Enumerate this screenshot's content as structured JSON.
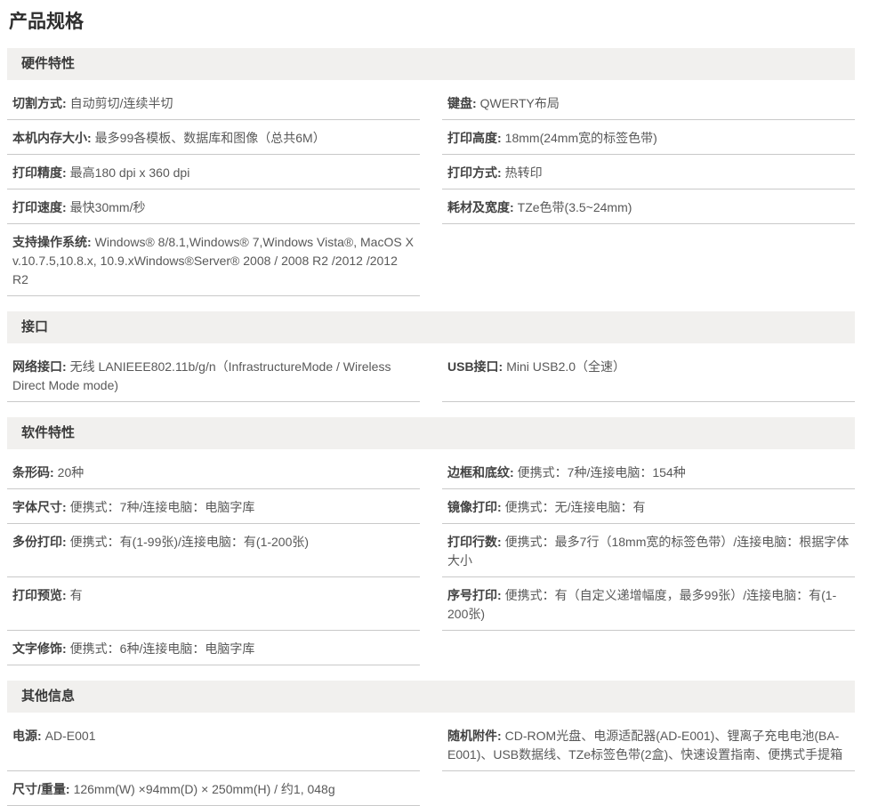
{
  "page": {
    "title": "产品规格"
  },
  "colors": {
    "section_header_bg": "#f1f0ee",
    "row_border": "#c9c9c9",
    "label_text": "#424242",
    "value_text": "#595959"
  },
  "sections": [
    {
      "header": "硬件特性",
      "rows": [
        {
          "left": {
            "label": "切割方式:",
            "value": "自动剪切/连续半切"
          },
          "right": {
            "label": "键盘:",
            "value": "QWERTY布局"
          }
        },
        {
          "left": {
            "label": "本机内存大小:",
            "value": "最多99各模板、数据库和图像（总共6M）"
          },
          "right": {
            "label": "打印高度:",
            "value": "18mm(24mm宽的标签色带)"
          }
        },
        {
          "left": {
            "label": "打印精度:",
            "value": "最高180 dpi x 360 dpi"
          },
          "right": {
            "label": "打印方式:",
            "value": "热转印"
          }
        },
        {
          "left": {
            "label": "打印速度:",
            "value": "最快30mm/秒"
          },
          "right": {
            "label": "耗材及宽度:",
            "value": "TZe色带(3.5~24mm)"
          }
        },
        {
          "left": {
            "label": "支持操作系统:",
            "value": "Windows® 8/8.1,Windows® 7,Windows Vista®, MacOS X v.10.7.5,10.8.x, 10.9.xWindows®Server® 2008 / 2008 R2 /2012 /2012 R2"
          }
        }
      ]
    },
    {
      "header": "接口",
      "rows": [
        {
          "left": {
            "label": "网络接口:",
            "value": "无线 LANIEEE802.11b/g/n（InfrastructureMode / Wireless Direct Mode mode)"
          },
          "right": {
            "label": "USB接口:",
            "value": "Mini USB2.0（全速）"
          }
        }
      ]
    },
    {
      "header": "软件特性",
      "rows": [
        {
          "left": {
            "label": "条形码:",
            "value": "20种"
          },
          "right": {
            "label": "边框和底纹:",
            "value": "便携式：7种/连接电脑：154种"
          }
        },
        {
          "left": {
            "label": "字体尺寸:",
            "value": "便携式：7种/连接电脑：电脑字库"
          },
          "right": {
            "label": "镜像打印:",
            "value": "便携式：无/连接电脑：有"
          }
        },
        {
          "left": {
            "label": "多份打印:",
            "value": "便携式：有(1-99张)/连接电脑：有(1-200张)"
          },
          "right": {
            "label": "打印行数:",
            "value": "便携式：最多7行（18mm宽的标签色带）/连接电脑：根据字体大小"
          }
        },
        {
          "left": {
            "label": "打印预览:",
            "value": "有"
          },
          "right": {
            "label": "序号打印:",
            "value": "便携式：有（自定义递增幅度，最多99张）/连接电脑：有(1-200张)"
          }
        },
        {
          "left": {
            "label": "文字修饰:",
            "value": "便携式：6种/连接电脑：电脑字库"
          }
        }
      ]
    },
    {
      "header": "其他信息",
      "rows": [
        {
          "left": {
            "label": "电源:",
            "value": "AD-E001"
          },
          "right": {
            "label": "随机附件:",
            "value": "CD-ROM光盘、电源适配器(AD-E001)、锂离子充电电池(BA-E001)、USB数据线、TZe标签色带(2盒)、快速设置指南、便携式手提箱"
          }
        },
        {
          "left": {
            "label": "尺寸/重量:",
            "value": "126mm(W) ×94mm(D) × 250mm(H) / 约1, 048g"
          }
        }
      ]
    }
  ]
}
